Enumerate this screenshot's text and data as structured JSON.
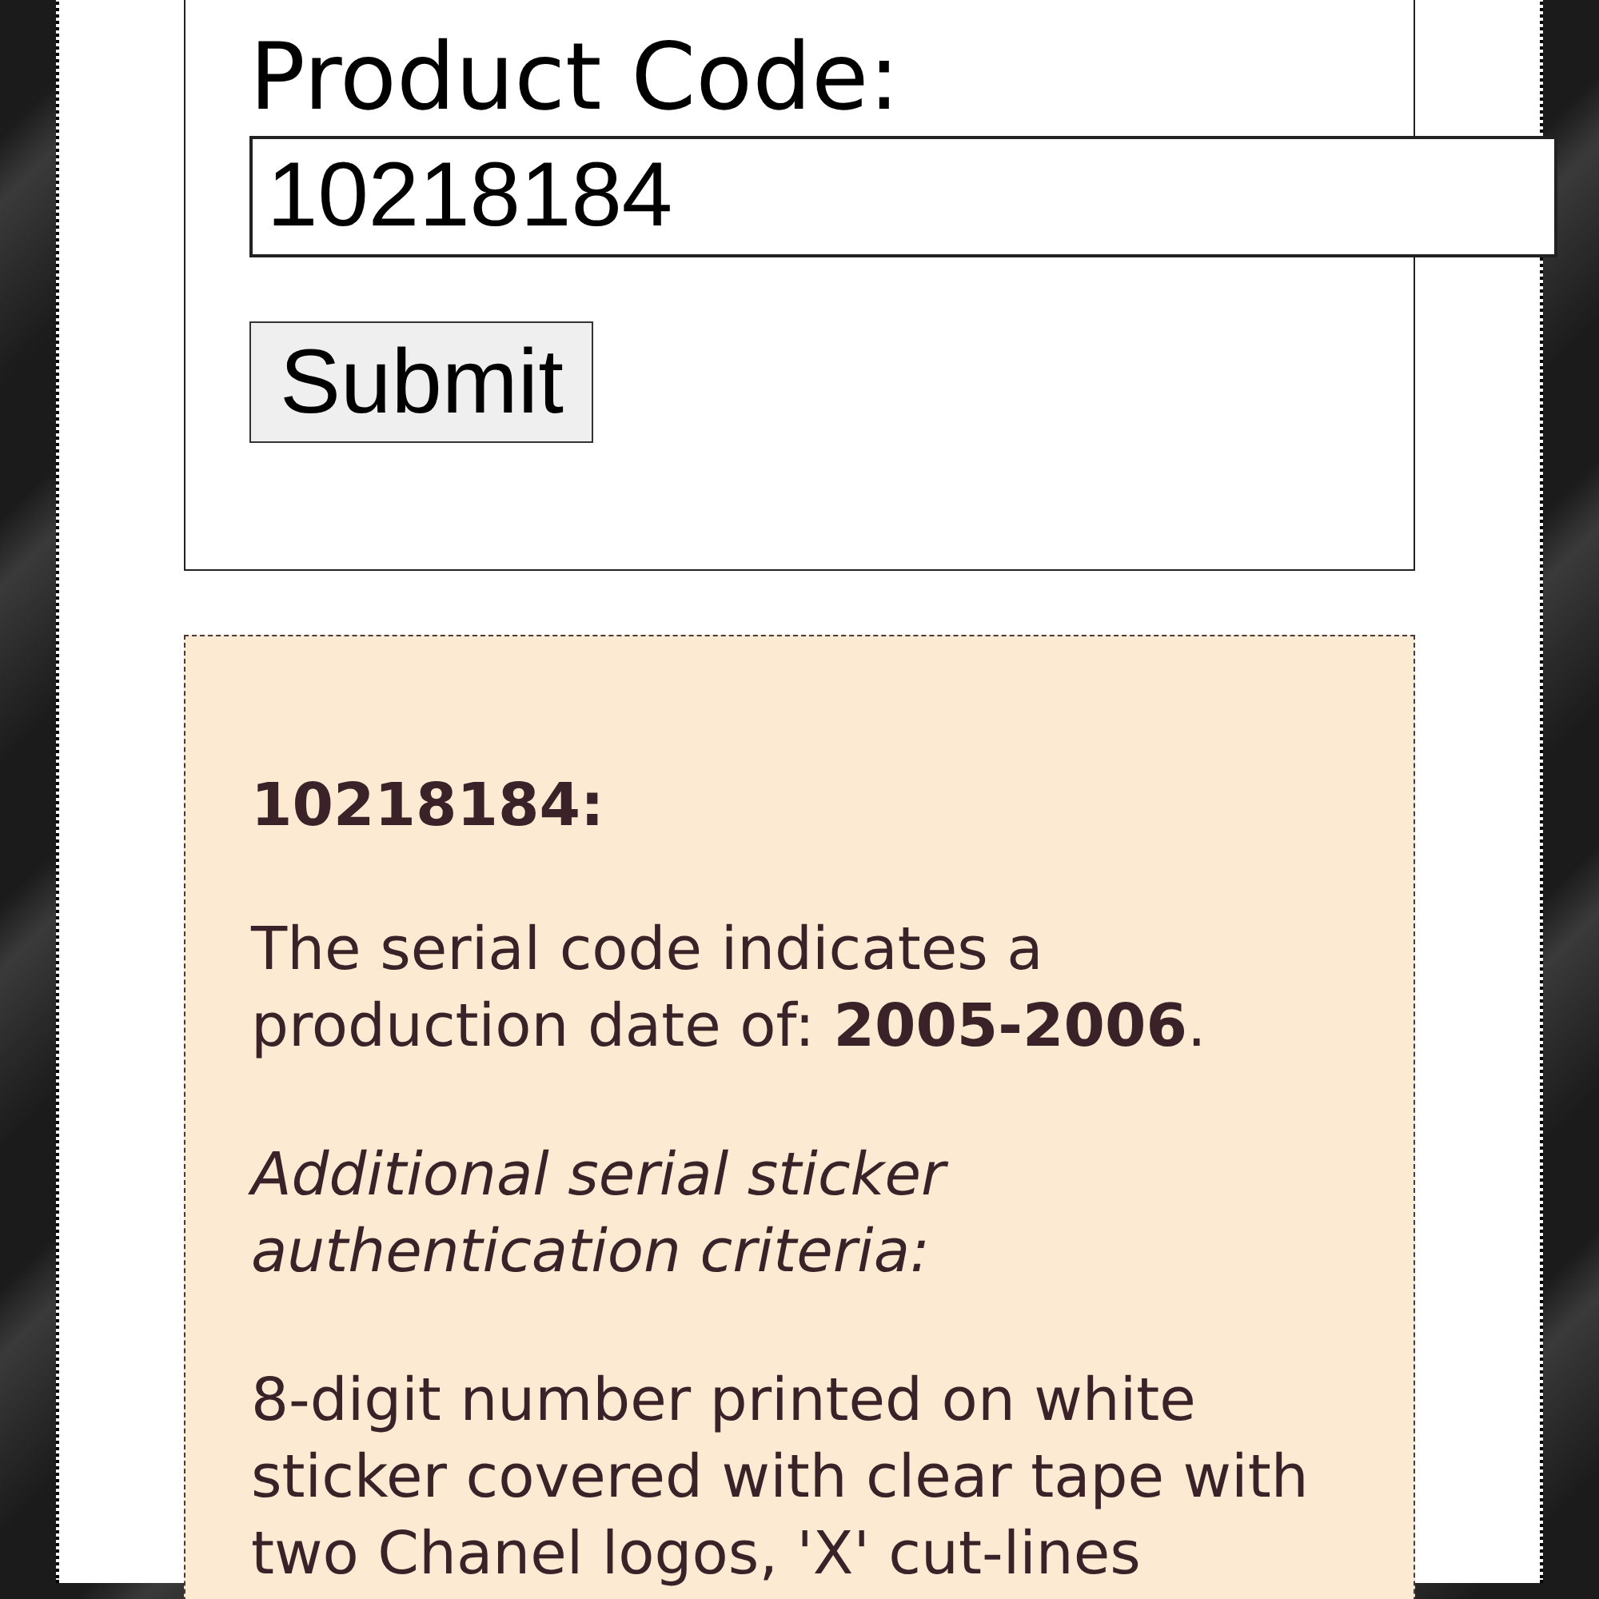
{
  "form": {
    "label": "Product Code:",
    "input": {
      "value": "10218184"
    },
    "submit_button": "Submit"
  },
  "result": {
    "heading": "10218184:",
    "paragraphs": [
      {
        "kind": "plain",
        "text": "The serial code indicates a production date of: **2005-2006**."
      },
      {
        "kind": "italic",
        "text": "Additional serial sticker authentication criteria:"
      },
      {
        "kind": "plain",
        "text": "8-digit number printed on white sticker covered with clear tape with two Chanel logos, 'X' cut-lines"
      }
    ]
  }
}
